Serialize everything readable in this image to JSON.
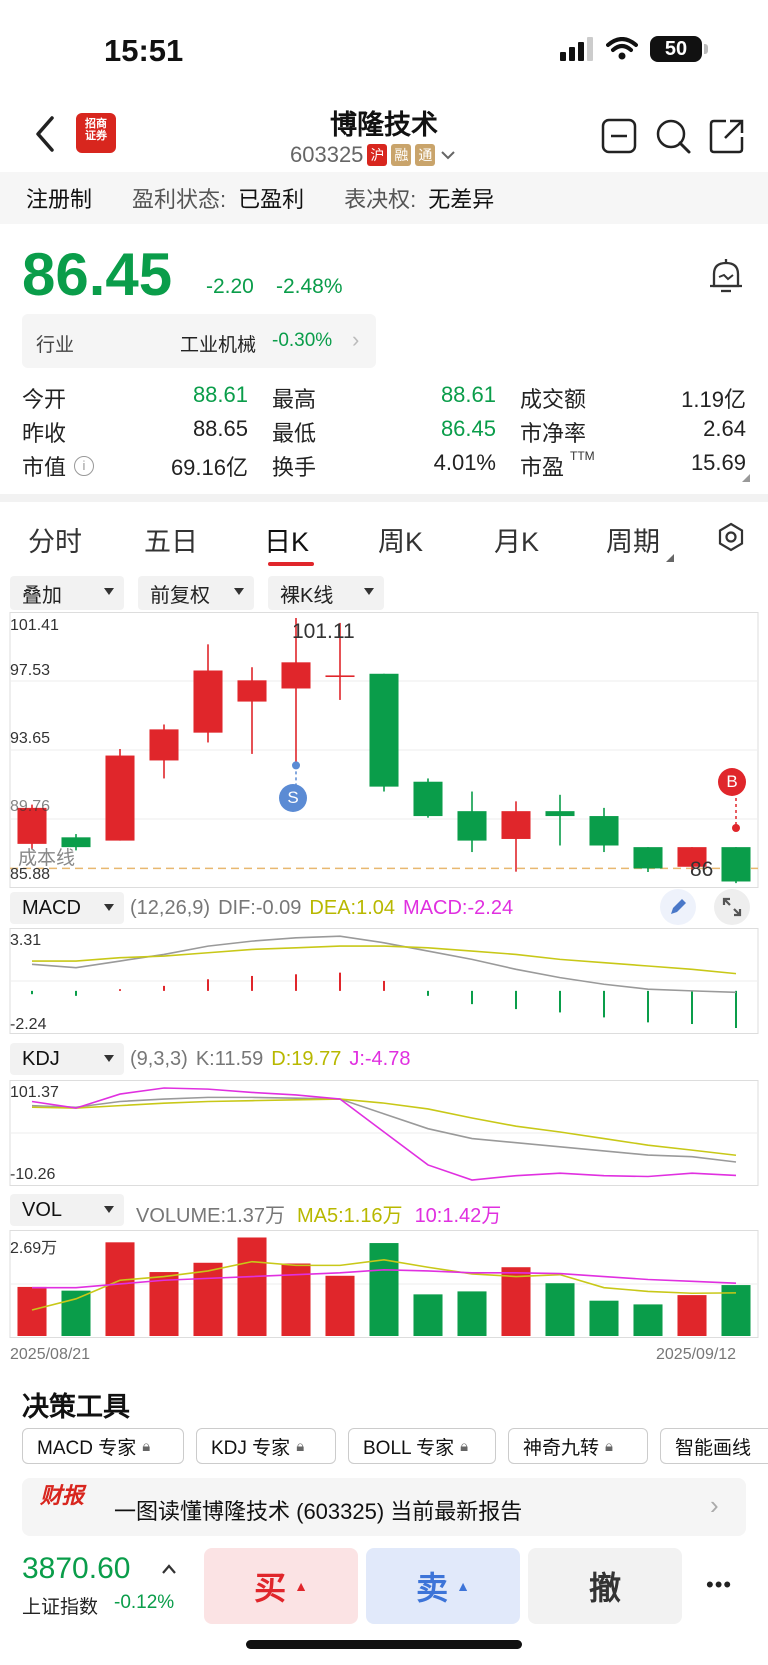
{
  "status_bar": {
    "time": "15:51",
    "battery": "50"
  },
  "header": {
    "name": "博隆技术",
    "code": "603325",
    "badges": [
      "沪",
      "融",
      "通"
    ],
    "broker_logo_text": "招商证券"
  },
  "info_strip": {
    "reg": "注册制",
    "profit_label": "盈利状态:",
    "profit_value": "已盈利",
    "vote_label": "表决权:",
    "vote_value": "无差异"
  },
  "quote": {
    "price": "86.45",
    "change": "-2.20",
    "change_pct": "-2.48%",
    "industry_label": "行业",
    "industry_name": "工业机械",
    "industry_pct": "-0.30%"
  },
  "stats": [
    {
      "label": "今开",
      "value": "88.61",
      "color": "#0a9d4a"
    },
    {
      "label": "最高",
      "value": "88.61",
      "color": "#0a9d4a"
    },
    {
      "label": "成交额",
      "value": "1.19亿",
      "color": "#222222"
    },
    {
      "label": "昨收",
      "value": "88.65",
      "color": "#222222"
    },
    {
      "label": "最低",
      "value": "86.45",
      "color": "#0a9d4a"
    },
    {
      "label": "市净率",
      "value": "2.64",
      "color": "#222222"
    },
    {
      "label": "市值",
      "value": "69.16亿",
      "color": "#222222"
    },
    {
      "label": "换手",
      "value": "4.01%",
      "color": "#222222"
    },
    {
      "label": "市盈",
      "value": "15.69",
      "color": "#222222"
    }
  ],
  "pe_suffix": "TTM",
  "period_tabs": [
    "分时",
    "五日",
    "日K",
    "周K",
    "月K",
    "周期"
  ],
  "active_tab": "日K",
  "chart_dropdowns": [
    "叠加",
    "前复权",
    "裸K线"
  ],
  "kline": {
    "y_ticks": [
      "101.41",
      "97.53",
      "93.65",
      "89.76",
      "85.88"
    ],
    "high_label": "101.11",
    "low_label": "86",
    "cost_label": "成本线",
    "s_marker": "S",
    "b_marker": "B"
  },
  "macd": {
    "name": "MACD",
    "params": "(12,26,9)",
    "dif": "DIF:-0.09",
    "dea": "DEA:1.04",
    "macd": "MACD:-2.24",
    "ymax": "3.31",
    "ymin": "-2.24"
  },
  "kdj": {
    "name": "KDJ",
    "params": "(9,3,3)",
    "k": "K:11.59",
    "d": "D:19.77",
    "j": "J:-4.78",
    "ymax": "101.37",
    "ymin": "-10.26"
  },
  "vol": {
    "name": "VOL",
    "volume": "VOLUME:1.37万",
    "ma5": "MA5:1.16万",
    "ma10": "10:1.42万",
    "ymax": "2.69万"
  },
  "dates": {
    "start": "2025/08/21",
    "end": "2025/09/12"
  },
  "decision": {
    "title": "决策工具",
    "tools": [
      "MACD 专家",
      "KDJ 专家",
      "BOLL 专家",
      "神奇九转",
      "智能画线"
    ]
  },
  "report": {
    "logo": "财报",
    "text": "一图读懂博隆技术 (603325) 当前最新报告"
  },
  "bottom": {
    "index_value": "3870.60",
    "index_name": "上证指数",
    "index_pct": "-0.12%",
    "buy": "买",
    "sell": "卖",
    "cancel": "撤",
    "more": "•••"
  },
  "chart_data": {
    "type": "candlestick",
    "x_start": "2025/08/21",
    "x_end": "2025/09/12",
    "candles": [
      {
        "o": 87.6,
        "c": 89.8,
        "h": 90.0,
        "l": 87.3
      },
      {
        "o": 88.0,
        "c": 87.4,
        "h": 88.2,
        "l": 87.2
      },
      {
        "o": 87.8,
        "c": 93.0,
        "h": 93.4,
        "l": 87.8
      },
      {
        "o": 92.7,
        "c": 94.6,
        "h": 94.9,
        "l": 91.6
      },
      {
        "o": 94.4,
        "c": 98.2,
        "h": 99.8,
        "l": 93.8
      },
      {
        "o": 96.3,
        "c": 97.6,
        "h": 98.4,
        "l": 93.1
      },
      {
        "o": 97.1,
        "c": 98.7,
        "h": 101.41,
        "l": 92.4
      },
      {
        "o": 97.9,
        "c": 97.9,
        "h": 101.11,
        "l": 96.4
      },
      {
        "o": 98.0,
        "c": 91.1,
        "h": 98.0,
        "l": 90.8
      },
      {
        "o": 91.4,
        "c": 89.3,
        "h": 91.6,
        "l": 89.2
      },
      {
        "o": 89.6,
        "c": 87.8,
        "h": 90.8,
        "l": 87.1
      },
      {
        "o": 87.9,
        "c": 89.6,
        "h": 90.2,
        "l": 85.9
      },
      {
        "o": 89.6,
        "c": 89.3,
        "h": 90.6,
        "l": 87.5
      },
      {
        "o": 89.3,
        "c": 87.5,
        "h": 89.8,
        "l": 87.1
      },
      {
        "o": 87.4,
        "c": 86.1,
        "h": 87.4,
        "l": 85.88
      },
      {
        "o": 86.2,
        "c": 87.4,
        "h": 87.4,
        "l": 85.9
      },
      {
        "o": 87.4,
        "c": 85.3,
        "h": 87.4,
        "l": 85.2
      }
    ],
    "ylim": [
      85.88,
      101.41
    ],
    "cost_line": 86.1,
    "macd_hist": [
      -0.2,
      -0.3,
      0.1,
      0.3,
      0.7,
      0.9,
      1.0,
      1.1,
      0.6,
      -0.3,
      -0.8,
      -1.1,
      -1.3,
      -1.6,
      -1.9,
      -2.0,
      -2.24
    ],
    "macd_dif": [
      1.6,
      1.4,
      1.8,
      2.2,
      2.7,
      3.0,
      3.2,
      3.3,
      2.9,
      2.4,
      1.9,
      1.3,
      0.8,
      0.4,
      0.1,
      0.0,
      -0.09
    ],
    "macd_dea": [
      1.8,
      1.8,
      2.0,
      2.1,
      2.3,
      2.5,
      2.6,
      2.7,
      2.7,
      2.6,
      2.4,
      2.2,
      1.9,
      1.7,
      1.5,
      1.3,
      1.04
    ],
    "macd_ylim": [
      -2.24,
      3.31
    ],
    "kdj_k": [
      80,
      78,
      85,
      88,
      90,
      90,
      89,
      88,
      70,
      52,
      40,
      35,
      30,
      25,
      20,
      18,
      11.59
    ],
    "kdj_d": [
      78,
      77,
      80,
      83,
      85,
      86,
      87,
      88,
      83,
      76,
      65,
      55,
      48,
      40,
      32,
      26,
      19.77
    ],
    "kdj_j": [
      85,
      77,
      94,
      101.37,
      100,
      96,
      93,
      88,
      48,
      8,
      -10.26,
      -5,
      -2,
      -5,
      -6,
      -2,
      -4.78
    ],
    "kdj_ylim": [
      -10.26,
      101.37
    ],
    "volume": [
      1.32,
      1.22,
      2.52,
      1.72,
      1.97,
      2.65,
      1.95,
      1.62,
      2.5,
      1.12,
      1.2,
      1.85,
      1.42,
      0.95,
      0.85,
      1.1,
      1.37
    ],
    "vol_ma5": [
      0.7,
      1.0,
      1.5,
      1.6,
      1.75,
      2.0,
      1.9,
      1.9,
      2.05,
      1.85,
      1.67,
      1.6,
      1.65,
      1.3,
      1.2,
      1.15,
      1.16
    ],
    "vol_ma10": [
      1.3,
      1.3,
      1.4,
      1.5,
      1.55,
      1.6,
      1.65,
      1.7,
      1.78,
      1.75,
      1.7,
      1.7,
      1.68,
      1.6,
      1.52,
      1.47,
      1.42
    ],
    "vol_ylim": [
      0,
      2.69
    ],
    "colors": {
      "up": "#e0262b",
      "down": "#0a9d4a",
      "dif": "#9a9a9a",
      "dea": "#c8c818",
      "j": "#e030e0",
      "ma5": "#c8c818",
      "ma10": "#e030e0"
    }
  }
}
